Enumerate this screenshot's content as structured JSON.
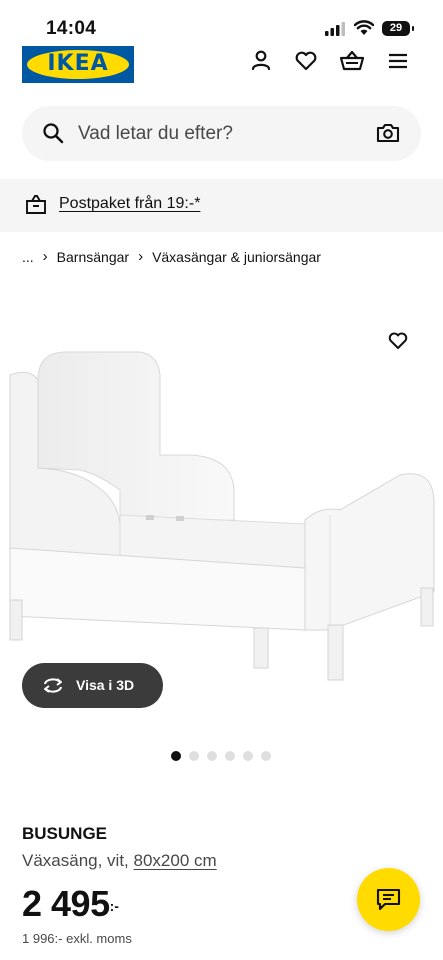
{
  "status_bar": {
    "time": "14:04",
    "battery": "29"
  },
  "header": {
    "logo_text": "IKEA",
    "icons": [
      "account-icon",
      "wishlist-heart-icon",
      "shopping-basket-icon",
      "hamburger-menu-icon"
    ]
  },
  "search": {
    "placeholder": "Vad letar du efter?"
  },
  "banner": {
    "text": "Postpaket från 19:-*"
  },
  "breadcrumb": {
    "ellipsis": "...",
    "items": [
      "Barnsängar",
      "Växasängar & juniorsängar"
    ]
  },
  "gallery": {
    "view_3d_label": "Visa i 3D",
    "total_images": 6,
    "active_index": 0
  },
  "product": {
    "name": "BUSUNGE",
    "description_prefix": "Växasäng, vit,",
    "size": "80x200 cm",
    "price_integer": "2 495",
    "price_suffix": ":-",
    "price_excl_vat": "1 996:- exkl. moms"
  },
  "colors": {
    "ikea_blue": "#0058a3",
    "ikea_yellow": "#ffdb00",
    "dark_button": "#3b3b3b"
  }
}
